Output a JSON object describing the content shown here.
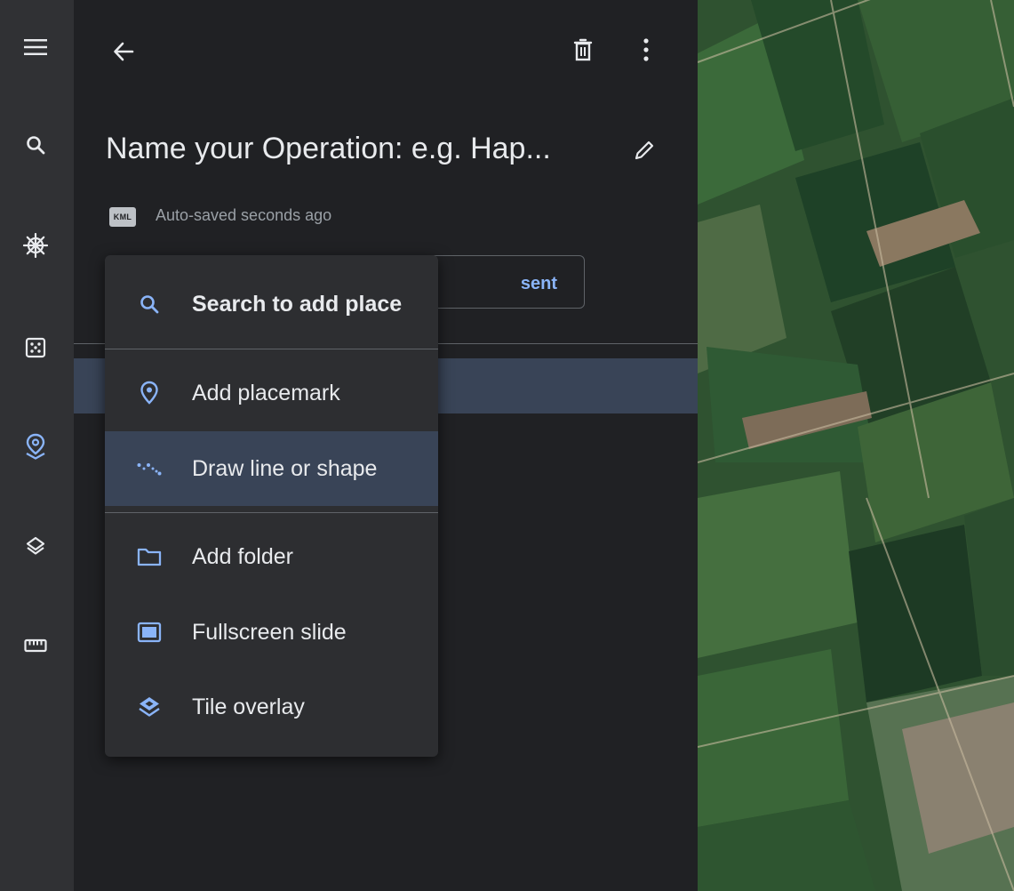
{
  "rail": {
    "items": [
      "menu-icon",
      "search-icon",
      "voyager-wheel-icon",
      "dice-icon",
      "projects-icon",
      "layers-icon",
      "ruler-icon"
    ],
    "active": "projects-icon",
    "accent": "#8ab4f8"
  },
  "header": {
    "back_icon": "arrow-back-icon",
    "delete_icon": "trash-icon",
    "more_icon": "more-vert-icon"
  },
  "project": {
    "title": "Name your Operation: e.g. Hap...",
    "edit_icon": "pencil-icon",
    "kml_badge": "KML",
    "saved_status": "Auto-saved seconds ago",
    "present_label_visible": "sent"
  },
  "menu": {
    "items": [
      {
        "label": "Search to add place",
        "icon": "search-icon"
      },
      {
        "label": "Add placemark",
        "icon": "location-pin-icon"
      },
      {
        "label": "Draw line or shape",
        "icon": "line-shape-icon"
      },
      {
        "label": "Add folder",
        "icon": "folder-icon"
      },
      {
        "label": "Fullscreen slide",
        "icon": "slide-icon"
      },
      {
        "label": "Tile overlay",
        "icon": "tile-overlay-icon"
      }
    ],
    "highlighted": "Draw line or shape"
  },
  "colors": {
    "background": "#202124",
    "rail": "#303134",
    "menu": "#2d2e31",
    "highlight": "#394457",
    "accent": "#8ab4f8",
    "text": "#e8eaed"
  }
}
